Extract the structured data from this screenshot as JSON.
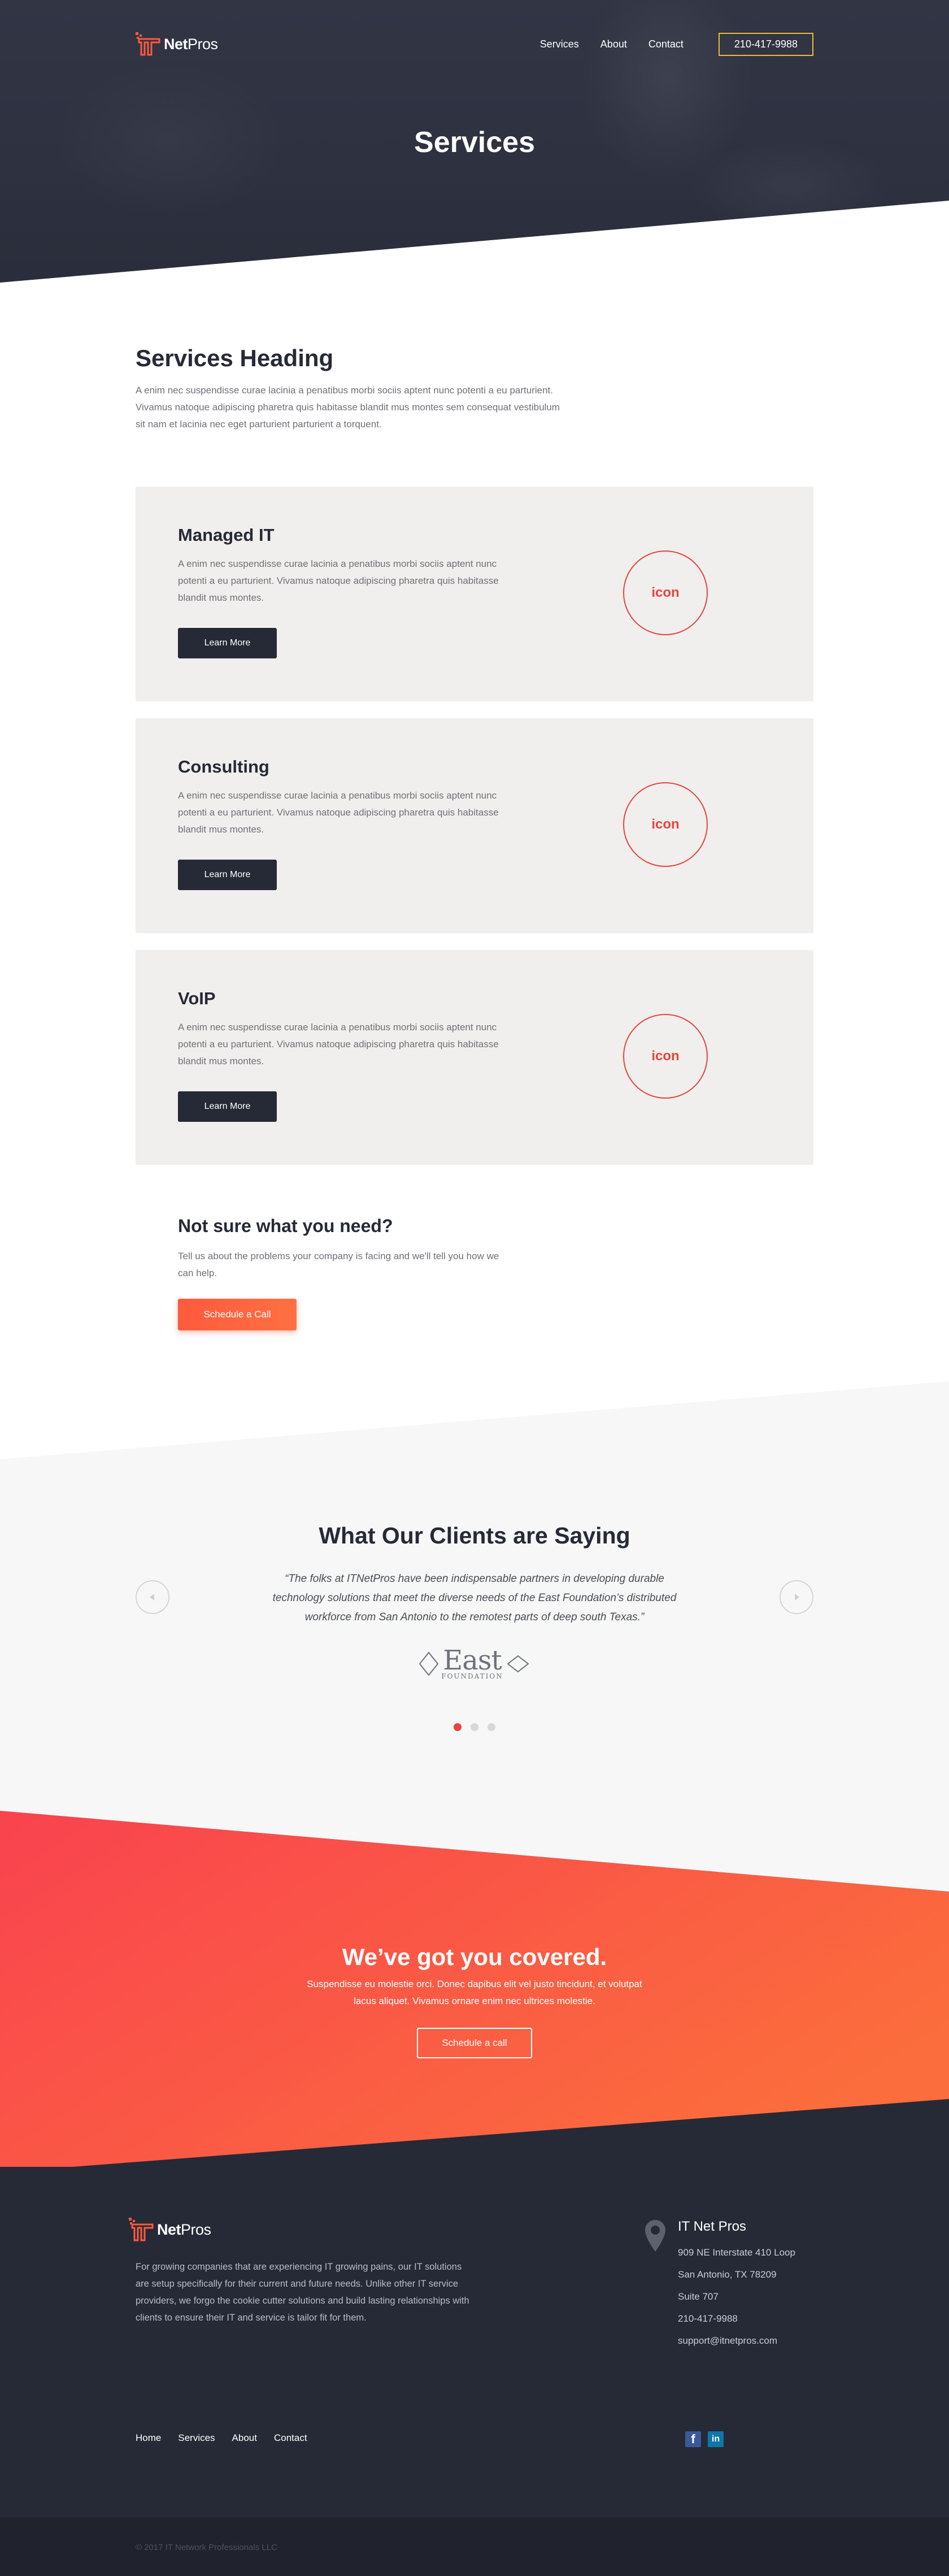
{
  "header": {
    "logo_it": "IT",
    "logo_net": "Net",
    "logo_pros": "Pros",
    "nav": [
      "Services",
      "About",
      "Contact"
    ],
    "phone": "210-417-9988",
    "page_title": "Services"
  },
  "intro": {
    "heading": "Services Heading",
    "text": "A enim nec suspendisse curae lacinia a penatibus morbi sociis aptent nunc potenti a eu parturient. Vivamus natoque adipiscing pharetra quis habitasse blandit mus montes sem consequat vestibulum sit nam et lacinia nec eget parturient parturient a torquent."
  },
  "services": [
    {
      "title": "Managed IT",
      "text": "A enim nec suspendisse curae lacinia a penatibus morbi sociis aptent nunc potenti a eu parturient. Vivamus natoque adipiscing pharetra quis habitasse blandit mus montes.",
      "button": "Learn More",
      "icon": "icon"
    },
    {
      "title": "Consulting",
      "text": "A enim nec suspendisse curae lacinia a penatibus morbi sociis aptent nunc potenti a eu parturient. Vivamus natoque adipiscing pharetra quis habitasse blandit mus montes.",
      "button": "Learn More",
      "icon": "icon"
    },
    {
      "title": "VoIP",
      "text": "A enim nec suspendisse curae lacinia a penatibus morbi sociis aptent nunc potenti a eu parturient. Vivamus natoque adipiscing pharetra quis habitasse blandit mus montes.",
      "button": "Learn More",
      "icon": "icon"
    }
  ],
  "not_sure": {
    "heading": "Not sure what you need?",
    "text": "Tell us about the problems your company is facing and we'll tell you how we can help.",
    "button": "Schedule a Call"
  },
  "testimonials": {
    "heading": "What Our Clients are Saying",
    "quote": "“The folks at ITNetPros have been indispensable partners in developing durable technology solutions that meet the diverse needs of the East Foundation’s distributed workforce from San Antonio to the remotest parts of deep south Texas.”",
    "client_name": "East",
    "client_sub": "FOUNDATION",
    "active_slide": 1,
    "slide_count": 3
  },
  "cta": {
    "heading": "We’ve got you covered.",
    "text": "Suspendisse eu molestie orci. Donec dapibus elit vel justo tincidunt, et volutpat lacus aliquet. Vivamus ornare enim nec ultrices molestie.",
    "button": "Schedule a call"
  },
  "footer": {
    "description": "For growing companies that are experiencing IT growing pains, our IT solutions are setup specifically for their current and future needs. Unlike other IT service providers, we forgo the cookie cutter solutions and build lasting relationships with clients to ensure their IT and service is tailor fit for them.",
    "contact_title": "IT Net Pros",
    "address1": "909 NE Interstate 410 Loop",
    "address2": "San Antonio, TX 78209",
    "address3": "Suite 707",
    "phone": "210-417-9988",
    "email": "support@itnetpros.com",
    "links": [
      "Home",
      "Services",
      "About",
      "Contact"
    ],
    "social": [
      "facebook-icon",
      "linkedin-icon"
    ],
    "copyright": "© 2017 IT Network Professionals LLC"
  },
  "colors": {
    "accent": "#e8433f",
    "dark": "#262a36",
    "gold": "#f4b73a",
    "cta_gradient_start": "#f9434f",
    "cta_gradient_end": "#fb6d3c"
  }
}
